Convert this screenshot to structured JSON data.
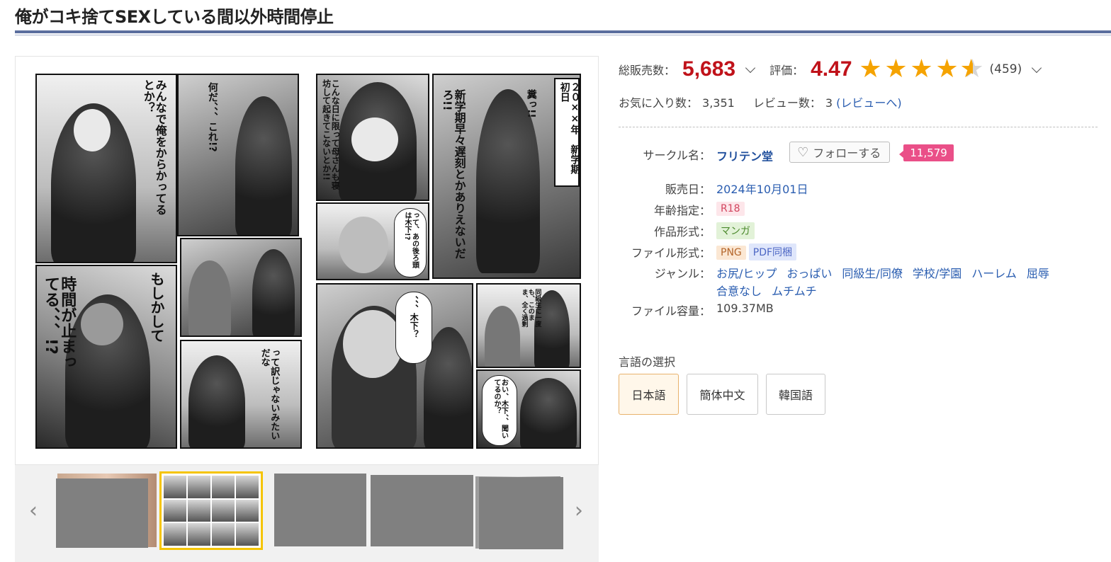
{
  "title": "俺がコキ捨てSEXしている間以外時間停止",
  "stats": {
    "sales_label": "総販売数：",
    "sales_value": "5,683",
    "rating_label": "評価：",
    "rating_value": "4.47",
    "rating_stars": 4.47,
    "rating_count": "(459)",
    "favorites_label": "お気に入り数：",
    "favorites_value": "3,351",
    "reviews_label": "レビュー数：",
    "reviews_value": "3",
    "reviews_link": "(レビューへ)"
  },
  "circle": {
    "label": "サークル名：",
    "name": "フリテン堂",
    "follow_label": "フォローする",
    "follow_count": "11,579"
  },
  "specs": {
    "release_label": "販売日：",
    "release_value": "2024年10月01日",
    "age_label": "年齢指定：",
    "age_value": "R18",
    "format_label": "作品形式：",
    "format_value": "マンガ",
    "file_format_label": "ファイル形式：",
    "file_formats": [
      "PNG",
      "PDF同梱"
    ],
    "genre_label": "ジャンル：",
    "genres": [
      "お尻/ヒップ",
      "おっぱい",
      "同級生/同僚",
      "学校/学園",
      "ハーレム",
      "屈辱",
      "合意なし",
      "ムチムチ"
    ],
    "size_label": "ファイル容量：",
    "size_value": "109.37MB"
  },
  "language": {
    "title": "言語の選択",
    "options": [
      "日本語",
      "簡体中文",
      "韓国語"
    ],
    "selected": "日本語"
  },
  "manga": {
    "caption_date": "２０××年　新学期初日",
    "text_1": "みんなで俺をからかってるとか？",
    "text_2": "何だ、、、これ!?",
    "text_3": "こんな日に限って母さんも寝坊して起きてこないとか!!",
    "text_4": "糞っ!!",
    "text_5": "新学期早々遅刻とかありえないだろ!!",
    "text_6": "って、あの後ろ頭は木下!?",
    "text_7": "もしかして",
    "text_8": "時間が止まってる、、、!?",
    "text_9": "、、、木下？",
    "text_10": "って訳じゃないみたいだな",
    "text_11": "おい、木下、、聞いてるのか？",
    "text_12": "同級生に一度も、このまま、全く過剰"
  },
  "thumbnails": {
    "prev_icon": "chevron-left-icon",
    "next_icon": "chevron-right-icon",
    "active_index": 1
  },
  "colors": {
    "accent_red": "#c0121a",
    "star": "#f5a300",
    "link": "#2a5db0",
    "follow_pink": "#ea4f88",
    "title_rule": "#5b6e9e",
    "thumb_highlight": "#f5c400"
  }
}
